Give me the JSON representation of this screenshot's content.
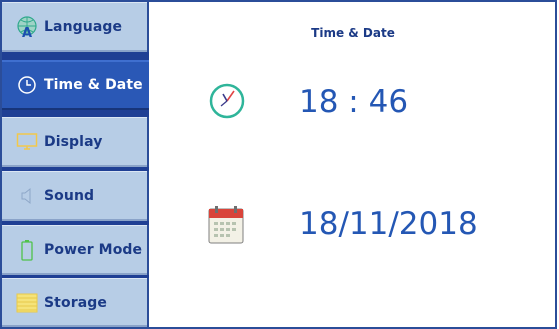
{
  "sidebar": {
    "items": [
      {
        "label": "Language",
        "icon": "globe-language-icon",
        "active": false
      },
      {
        "label": "Time & Date",
        "icon": "clock-icon",
        "active": true
      },
      {
        "label": "Display",
        "icon": "monitor-icon",
        "active": false
      },
      {
        "label": "Sound",
        "icon": "speaker-icon",
        "active": false
      },
      {
        "label": "Power Mode",
        "icon": "battery-icon",
        "active": false
      },
      {
        "label": "Storage",
        "icon": "storage-icon",
        "active": false
      }
    ]
  },
  "main": {
    "title": "Time & Date",
    "time": {
      "value": "18 : 46",
      "icon": "clock-icon"
    },
    "date": {
      "value": "18/11/2018",
      "icon": "calendar-icon"
    }
  },
  "colors": {
    "sidebar_bg": "#b7cde6",
    "active_bg": "#2a58b6",
    "text_blue": "#2457b4",
    "border": "#2b4d99",
    "clock_teal": "#2fb59a"
  }
}
